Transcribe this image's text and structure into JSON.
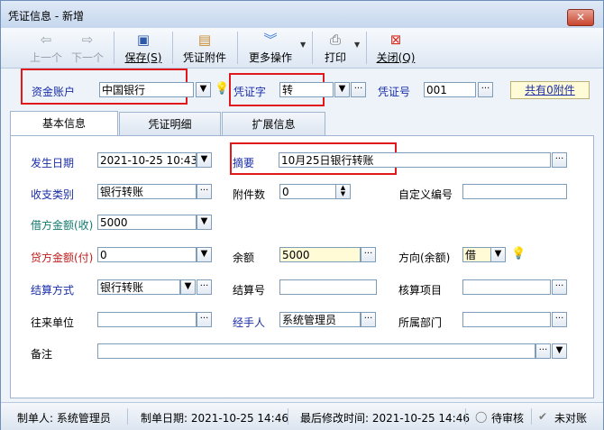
{
  "window": {
    "title": "凭证信息 - 新增",
    "close_glyph": "✕"
  },
  "toolbar": {
    "prev": "上一个",
    "next": "下一个",
    "save": "保存(S)",
    "attachment": "凭证附件",
    "more": "更多操作",
    "print": "打印",
    "close": "关闭(Q)"
  },
  "header": {
    "account_label": "资金账户",
    "account_value": "中国银行",
    "voucher_word_label": "凭证字",
    "voucher_word_value": "转",
    "voucher_no_label": "凭证号",
    "voucher_no_value": "001",
    "attachments_link": "共有0附件"
  },
  "tabs": [
    {
      "label": "基本信息",
      "active": true
    },
    {
      "label": "凭证明细",
      "active": false
    },
    {
      "label": "扩展信息",
      "active": false
    }
  ],
  "form": {
    "date_label": "发生日期",
    "date_value": "2021-10-25 10:43",
    "summary_label": "摘要",
    "summary_value": "10月25日银行转账",
    "category_label": "收支类别",
    "category_value": "银行转账",
    "attach_count_label": "附件数",
    "attach_count_value": "0",
    "custom_no_label": "自定义编号",
    "custom_no_value": "",
    "debit_label": "借方金额(收)",
    "debit_value": "5000",
    "credit_label": "贷方金额(付)",
    "credit_value": "0",
    "balance_label": "余额",
    "balance_value": "5000",
    "direction_label": "方向(余额)",
    "direction_value": "借",
    "settle_method_label": "结算方式",
    "settle_method_value": "银行转账",
    "settle_no_label": "结算号",
    "settle_no_value": "",
    "accounting_item_label": "核算项目",
    "accounting_item_value": "",
    "counterparty_label": "往来单位",
    "counterparty_value": "",
    "handler_label": "经手人",
    "handler_value": "系统管理员",
    "department_label": "所属部门",
    "department_value": "",
    "remark_label": "备注",
    "remark_value": ""
  },
  "status": {
    "creator": "制单人: 系统管理员",
    "created_date": "制单日期: 2021-10-25 14:46",
    "modified": "最后修改时间: 2021-10-25 14:46",
    "review": "待审核",
    "reconcile": "未对账"
  },
  "colors": {
    "highlight_box": "#e0191d",
    "field_border": "#7f9db9",
    "label_blue": "#1a2ea8",
    "label_red": "#c21b1b"
  },
  "icons": [
    "arrow-left-icon",
    "arrow-right-icon",
    "save-icon",
    "clipboard-icon",
    "double-chevron-icon",
    "printer-icon",
    "close-red-icon",
    "lightbulb-icon",
    "ellipsis-icon",
    "dropdown-arrow-icon",
    "spinner-icon",
    "status-circle-icon",
    "check-icon"
  ]
}
